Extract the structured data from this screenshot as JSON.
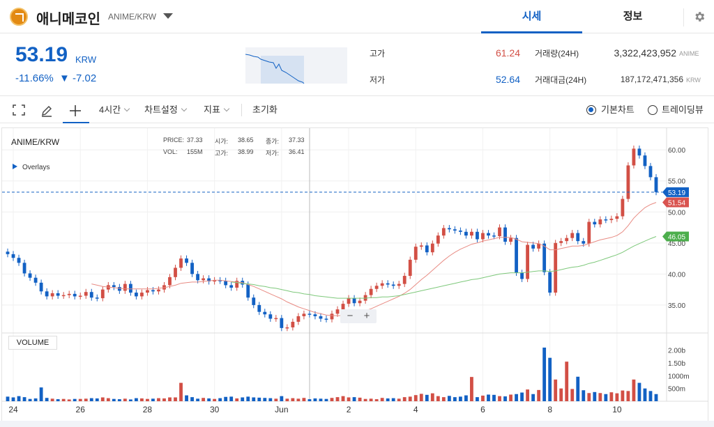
{
  "header": {
    "coin_name": "애니메코인",
    "pair": "ANIME/KRW",
    "tabs": [
      {
        "label": "시세"
      },
      {
        "label": "정보"
      }
    ]
  },
  "price": {
    "current": "53.19",
    "unit": "KRW",
    "change_rate": "-11.66%",
    "change_arrow": "▼",
    "change_amount": "-7.02"
  },
  "stats": {
    "high_label": "고가",
    "high": "61.24",
    "low_label": "저가",
    "low": "52.64",
    "volume_label": "거래량(24H)",
    "volume": "3,322,423,952",
    "volume_unit": "ANIME",
    "amount_label": "거래대금(24H)",
    "amount": "187,172,471,356",
    "amount_unit": "KRW"
  },
  "toolbar": {
    "interval": "4시간",
    "chart_settings": "차트설정",
    "indicators": "지표",
    "reset": "초기화",
    "basic_chart": "기본차트",
    "tradingview": "트레이딩뷰"
  },
  "chart_data": {
    "type": "candlestick",
    "title": "ANIME/KRW",
    "overlays_label": "Overlays",
    "ohlc_info": {
      "price_label": "PRICE:",
      "price": "37.33",
      "open_label": "시가:",
      "open": "38.65",
      "close_label": "종가:",
      "close": "37.33",
      "vol_label": "VOL:",
      "vol": "155M",
      "high_label": "고가:",
      "high": "38.99",
      "low_label": "저가:",
      "low": "36.41"
    },
    "y_ticks": [
      "60.00",
      "55.00",
      "50.00",
      "45.00",
      "40.00",
      "35.00"
    ],
    "y_tick_values": [
      60,
      55,
      50,
      45,
      40,
      35
    ],
    "ylim": [
      30.5,
      63.5
    ],
    "x_ticks": [
      {
        "label": "24",
        "x": 1
      },
      {
        "label": "26",
        "x": 13
      },
      {
        "label": "28",
        "x": 25
      },
      {
        "label": "30",
        "x": 37
      },
      {
        "label": "Jun",
        "x": 49
      },
      {
        "label": "2",
        "x": 61
      },
      {
        "label": "4",
        "x": 73
      },
      {
        "label": "6",
        "x": 85
      },
      {
        "label": "8",
        "x": 97
      },
      {
        "label": "10",
        "x": 109
      }
    ],
    "price_tag": "53.19",
    "price_tag_value": 53.19,
    "price_tag_color": "#1261c4",
    "ma_short_tag": "51.54",
    "ma_short_value": 51.54,
    "ma_short_color": "#d9534f",
    "ma_long_tag": "46.05",
    "ma_long_value": 46.05,
    "ma_long_color": "#4cae4c",
    "volume_label": "VOLUME",
    "volume_ticks": [
      "2.00b",
      "1.50b",
      "1000m",
      "500m"
    ],
    "volume_tick_values": [
      2000,
      1500,
      1000,
      500
    ],
    "volume_max": 2400,
    "up_color": "#d24f45",
    "down_color": "#1261c4",
    "closes": [
      43.2,
      42.6,
      41.8,
      40.1,
      39.4,
      38.6,
      37.2,
      36.4,
      36.9,
      36.5,
      36.6,
      36.8,
      36.4,
      36.5,
      37.1,
      36.2,
      36.1,
      37.5,
      38.2,
      37.9,
      37.3,
      38.4,
      37.0,
      36.4,
      37.0,
      37.4,
      37.2,
      37.5,
      38.2,
      39.5,
      41.0,
      42.5,
      41.8,
      40.0,
      39.0,
      39.3,
      38.8,
      39.0,
      38.9,
      38.2,
      37.8,
      38.9,
      38.3,
      36.2,
      35.0,
      33.9,
      33.5,
      32.8,
      32.9,
      31.3,
      31.4,
      32.3,
      33.2,
      33.6,
      33.5,
      33.2,
      32.8,
      32.7,
      33.6,
      34.3,
      35.2,
      36.1,
      35.3,
      35.7,
      36.6,
      37.6,
      38.1,
      38.5,
      38.3,
      38.1,
      38.4,
      39.7,
      42.3,
      44.4,
      44.6,
      43.5,
      44.9,
      46.2,
      47.4,
      47.2,
      47.0,
      46.8,
      46.2,
      46.8,
      45.6,
      46.6,
      46.2,
      46.1,
      47.5,
      45.2,
      45.8,
      40.2,
      39.2,
      44.7,
      44.1,
      44.9,
      40.3,
      37.0,
      45.0,
      45.3,
      45.8,
      46.6,
      45.3,
      44.9,
      48.4,
      48.0,
      48.8,
      48.7,
      48.9,
      49.3,
      52.1,
      57.5,
      60.2,
      59.1,
      57.4,
      55.6,
      53.2
    ],
    "ma_short": [
      null,
      null,
      null,
      null,
      null,
      null,
      null,
      null,
      null,
      null,
      null,
      null,
      null,
      null,
      null,
      38.4,
      38.2,
      38.0,
      37.9,
      37.8,
      37.7,
      37.6,
      37.6,
      37.6,
      37.6,
      37.6,
      37.6,
      37.7,
      37.8,
      38.0,
      38.2,
      38.5,
      38.6,
      38.7,
      38.7,
      38.8,
      38.9,
      39.0,
      39.0,
      38.9,
      38.8,
      38.7,
      38.6,
      38.3,
      38.0,
      37.6,
      37.2,
      36.8,
      36.4,
      36.0,
      35.5,
      35.1,
      34.7,
      34.4,
      34.1,
      33.8,
      33.6,
      33.4,
      33.3,
      33.3,
      33.3,
      33.4,
      33.6,
      33.8,
      34.1,
      34.4,
      34.8,
      35.2,
      35.6,
      36.0,
      36.4,
      36.9,
      37.5,
      38.3,
      39.1,
      39.8,
      40.6,
      41.4,
      42.2,
      42.9,
      43.5,
      44.0,
      44.4,
      44.8,
      45.0,
      45.3,
      45.5,
      45.7,
      45.9,
      45.9,
      45.9,
      45.6,
      45.2,
      45.1,
      45.0,
      44.9,
      44.5,
      43.9,
      43.9,
      44.1,
      44.3,
      44.5,
      44.5,
      44.6,
      44.9,
      45.2,
      45.5,
      45.7,
      45.9,
      46.2,
      46.8,
      47.8,
      49.0,
      49.9,
      50.7,
      51.2,
      51.54
    ],
    "ma_long": [
      null,
      null,
      null,
      null,
      null,
      null,
      null,
      null,
      null,
      null,
      null,
      null,
      null,
      null,
      null,
      null,
      null,
      null,
      null,
      null,
      null,
      null,
      null,
      null,
      null,
      null,
      null,
      null,
      null,
      null,
      null,
      null,
      null,
      null,
      null,
      null,
      null,
      null,
      null,
      null,
      38.7,
      38.6,
      38.5,
      38.4,
      38.3,
      38.1,
      38.0,
      37.8,
      37.7,
      37.5,
      37.3,
      37.1,
      37.0,
      36.8,
      36.7,
      36.5,
      36.4,
      36.3,
      36.2,
      36.1,
      36.1,
      36.1,
      36.1,
      36.1,
      36.1,
      36.2,
      36.2,
      36.3,
      36.3,
      36.4,
      36.5,
      36.7,
      36.9,
      37.1,
      37.3,
      37.5,
      37.7,
      37.9,
      38.1,
      38.3,
      38.5,
      38.7,
      38.9,
      39.1,
      39.2,
      39.4,
      39.6,
      39.8,
      40.0,
      40.1,
      40.2,
      40.2,
      40.2,
      40.3,
      40.4,
      40.5,
      40.5,
      40.4,
      40.5,
      40.7,
      40.9,
      41.1,
      41.2,
      41.4,
      41.7,
      41.9,
      42.2,
      42.5,
      42.8,
      43.1,
      43.5,
      44.0,
      44.5,
      44.9,
      45.3,
      45.7,
      46.05
    ],
    "volumes": [
      180,
      150,
      200,
      160,
      90,
      110,
      540,
      130,
      100,
      80,
      90,
      70,
      90,
      90,
      100,
      120,
      110,
      150,
      120,
      90,
      80,
      100,
      70,
      120,
      110,
      90,
      100,
      120,
      110,
      150,
      150,
      720,
      230,
      160,
      100,
      130,
      110,
      90,
      120,
      170,
      180,
      110,
      150,
      180,
      150,
      140,
      130,
      120,
      100,
      200,
      100,
      120,
      100,
      130,
      80,
      110,
      100,
      90,
      130,
      160,
      200,
      150,
      160,
      140,
      90,
      100,
      80,
      130,
      110,
      120,
      100,
      160,
      180,
      240,
      290,
      250,
      310,
      200,
      160,
      210,
      160,
      180,
      230,
      950,
      160,
      220,
      260,
      250,
      200,
      190,
      260,
      280,
      340,
      460,
      280,
      440,
      2100,
      1700,
      850,
      500,
      1550,
      480,
      960,
      430,
      320,
      360,
      320,
      280,
      350,
      310,
      420,
      400,
      850,
      720,
      500,
      400,
      280,
      130
    ]
  }
}
